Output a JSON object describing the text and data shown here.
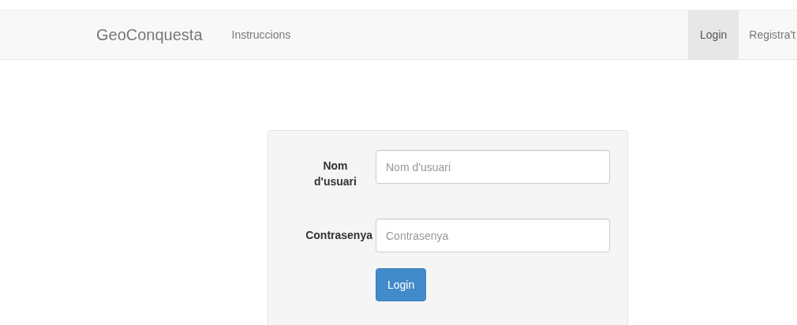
{
  "navbar": {
    "brand": "GeoConquesta",
    "left_items": [
      {
        "label": "Instruccions",
        "selected": false
      }
    ],
    "right_items": [
      {
        "label": "Login",
        "selected": true
      },
      {
        "label": "Registra't",
        "selected": false
      }
    ]
  },
  "login_form": {
    "fields": [
      {
        "label": "Nom d'usuari",
        "placeholder": "Nom d'usuari",
        "kind": "text"
      },
      {
        "label": "Contrasenya",
        "placeholder": "Contrasenya",
        "kind": "password"
      }
    ],
    "submit": "Login"
  }
}
